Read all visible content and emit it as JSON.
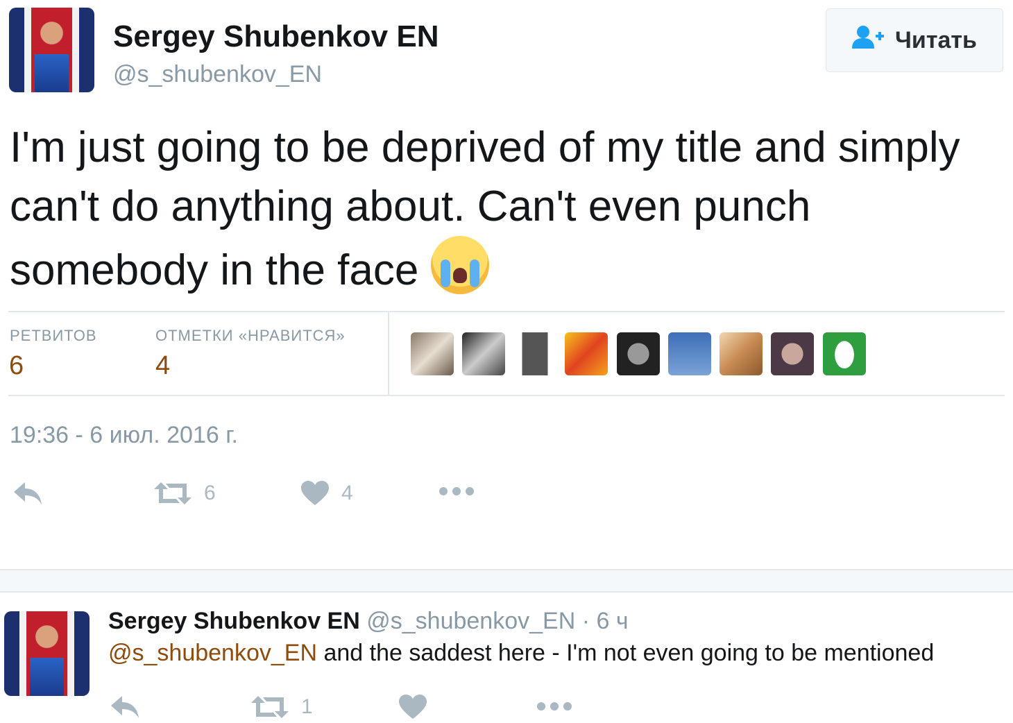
{
  "tweet": {
    "author_name": "Sergey Shubenkov EN",
    "author_handle": "@s_shubenkov_EN",
    "follow_label": "Читать",
    "text": "I'm just going to be deprived of my title and simply can't do anything about. Can't even punch somebody in the face",
    "emoji": "loudly-crying-face",
    "stats": {
      "retweets_label": "РЕТВИТОВ",
      "retweets_value": "6",
      "likes_label": "ОТМЕТКИ «НРАВИТСЯ»",
      "likes_value": "4"
    },
    "likers_count_shown": 9,
    "timestamp": "19:36 - 6 июл. 2016 г.",
    "actions": {
      "retweet_count": "6",
      "like_count": "4"
    }
  },
  "reply": {
    "author_name": "Sergey Shubenkov EN",
    "author_handle": "@s_shubenkov_EN",
    "time_sep": "·",
    "time": "6 ч",
    "mention": "@s_shubenkov_EN",
    "text": "and the saddest here - I'm not even going to be mentioned",
    "actions": {
      "retweet_count": "1"
    }
  },
  "colors": {
    "accent": "#8e4b0a",
    "muted": "#8899a6",
    "icon": "#aab8c2",
    "follow_icon": "#1da1f2"
  }
}
